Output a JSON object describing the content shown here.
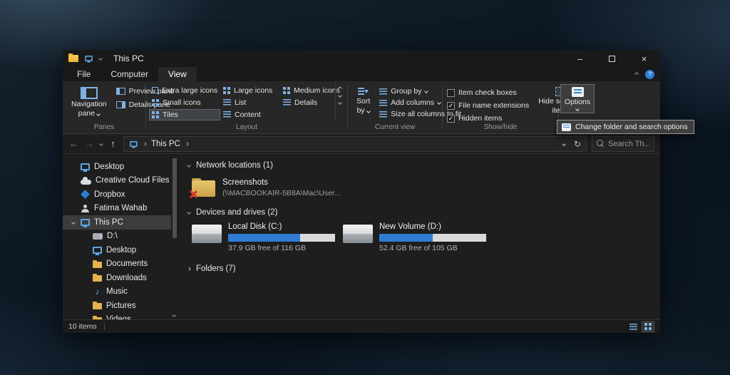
{
  "colors": {
    "accent": "#0078d7",
    "drive_bar_fill": "#2f7cd2",
    "drive_bar_track": "#d9d9d9",
    "selection": "#3c3c3c"
  },
  "glyphs": {
    "back": "←",
    "forward": "→",
    "up": "↑",
    "refresh": "↻",
    "minimize": "–",
    "close": "×",
    "help": "?",
    "music_note": "♪"
  },
  "titlebar": {
    "title": "This PC"
  },
  "tabs": [
    {
      "label": "File"
    },
    {
      "label": "Computer"
    },
    {
      "label": "View",
      "active": true
    }
  ],
  "ribbon": {
    "panes": {
      "group_label": "Panes",
      "navigation_line1": "Navigation",
      "navigation_line2": "pane",
      "preview": "Preview pane",
      "details": "Details pane"
    },
    "layout": {
      "group_label": "Layout",
      "options": [
        {
          "label": "Extra large icons"
        },
        {
          "label": "Large icons"
        },
        {
          "label": "Medium icons"
        },
        {
          "label": "Small icons"
        },
        {
          "label": "List"
        },
        {
          "label": "Details"
        },
        {
          "label": "Tiles",
          "selected": true
        },
        {
          "label": "Content"
        }
      ]
    },
    "current_view": {
      "group_label": "Current view",
      "sort_line1": "Sort",
      "sort_line2": "by",
      "group_by": "Group by",
      "add_columns": "Add columns",
      "size_columns": "Size all columns to fit"
    },
    "show_hide": {
      "group_label": "Show/hide",
      "checkboxes": [
        {
          "label": "Item check boxes",
          "checked": false,
          "mark": ""
        },
        {
          "label": "File name extensions",
          "checked": true,
          "mark": "✓"
        },
        {
          "label": "Hidden items",
          "checked": true,
          "mark": "✓"
        }
      ],
      "hide_line1": "Hide selected",
      "hide_line2": "items"
    },
    "options": {
      "label": "Options",
      "menu_item": "Change folder and search options"
    }
  },
  "address_bar": {
    "location": "This PC",
    "search_placeholder": "Search Th..."
  },
  "sidebar": {
    "items": [
      {
        "label": "Desktop",
        "level": 1,
        "icon": "monitor"
      },
      {
        "label": "Creative Cloud Files",
        "level": 1,
        "icon": "cloud"
      },
      {
        "label": "Dropbox",
        "level": 1,
        "icon": "dropbox"
      },
      {
        "label": "Fatima Wahab",
        "level": 1,
        "icon": "user"
      },
      {
        "label": "This PC",
        "level": 1,
        "icon": "pc",
        "selected": true
      },
      {
        "label": "D:\\",
        "level": 2,
        "icon": "drive"
      },
      {
        "label": "Desktop",
        "level": 2,
        "icon": "monitor"
      },
      {
        "label": "Documents",
        "level": 2,
        "icon": "folder"
      },
      {
        "label": "Downloads",
        "level": 2,
        "icon": "folder"
      },
      {
        "label": "Music",
        "level": 2,
        "icon": "music-note"
      },
      {
        "label": "Pictures",
        "level": 2,
        "icon": "folder"
      },
      {
        "label": "Videos",
        "level": 2,
        "icon": "folder"
      }
    ]
  },
  "main": {
    "network": {
      "header": "Network locations (1)",
      "item_name": "Screenshots",
      "item_path": "(\\\\MACBOOKAIR-5B8A\\Mac\\User..."
    },
    "devices": {
      "header": "Devices and drives (2)",
      "drives": [
        {
          "name": "Local Disk (C:)",
          "free": "37.9 GB free of 116 GB",
          "used": "67%"
        },
        {
          "name": "New Volume (D:)",
          "free": "52.4 GB free of 105 GB",
          "used": "50%"
        }
      ]
    },
    "folders": {
      "header": "Folders (7)"
    }
  },
  "status_bar": {
    "items_count": "10 items"
  }
}
